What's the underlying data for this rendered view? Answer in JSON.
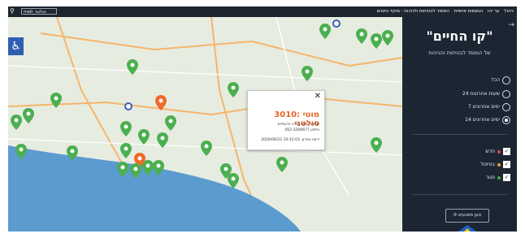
{
  "topbar": {
    "search_icon": "search-icon",
    "username": "moti_סולטני",
    "nav_items": [
      "ניהול",
      "ער יהו",
      "הגשמות אישיות",
      "המוסד לבטיחות ולגיהות - מוקד נתונים"
    ]
  },
  "map": {
    "accessibility_icon": "wheelchair-icon",
    "popup": {
      "close": "✕",
      "title": "3010: מוטי סולטני",
      "line1": "שלוחה מחוז מרכז וירושלים",
      "line2": "טלפון 052-3206677",
      "line3": "דיווח אחרון: 10:15:03 2020/06/22",
      "line4": "10:15:03 2020/06/22"
    }
  },
  "sidebar": {
    "collapse_icon": "arrow-right-icon",
    "title": "\"קו החיים\"",
    "subtitle": "של המוסד לבטיחות והגיהות",
    "time_filters": [
      {
        "label": "הכל",
        "selected": false
      },
      {
        "label": "24 שעות אחרונות",
        "selected": false
      },
      {
        "label": "7 ימים אחרונים",
        "selected": false
      },
      {
        "label": "14 ימים אחרונים",
        "selected": true
      }
    ],
    "status_filters": [
      {
        "label": "חדש",
        "color": "#e0453a",
        "checked": true
      },
      {
        "label": "בטיפול",
        "color": "#e8a13a",
        "checked": true
      },
      {
        "label": "סגור",
        "color": "#3fae49",
        "checked": true
      }
    ],
    "load_button": "⟳ טען מפגעים"
  },
  "colors": {
    "sidebar_bg": "#1c2633",
    "pin_green": "#4caf50",
    "pin_orange": "#f06a2a",
    "sea": "#5b9bd0"
  }
}
